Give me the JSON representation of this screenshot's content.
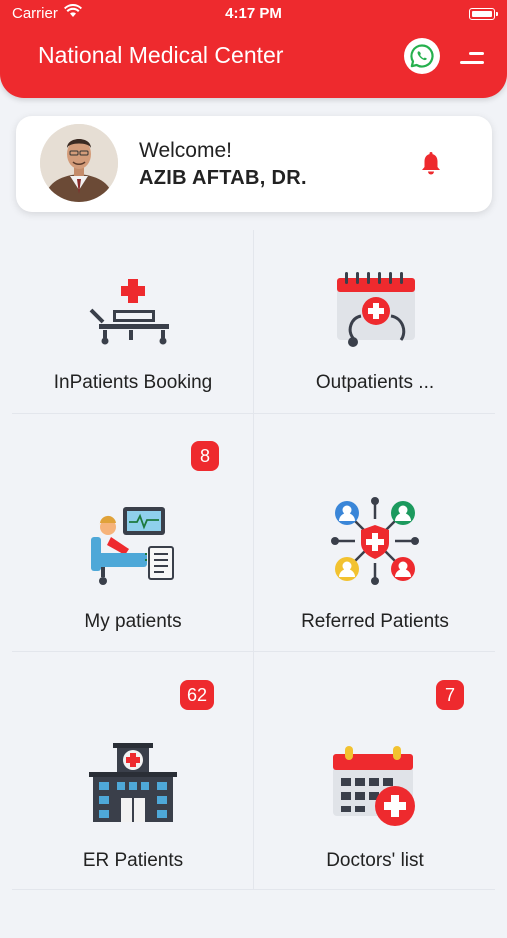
{
  "status_bar": {
    "carrier": "Carrier",
    "time": "4:17 PM"
  },
  "header": {
    "title": "National Medical Center"
  },
  "profile": {
    "welcome": "Welcome!",
    "name": "AZIB AFTAB, DR."
  },
  "tiles": [
    {
      "label": "InPatients Booking",
      "badge": ""
    },
    {
      "label": "Outpatients ...",
      "badge": ""
    },
    {
      "label": "My patients",
      "badge": "8"
    },
    {
      "label": "Referred Patients",
      "badge": ""
    },
    {
      "label": "ER Patients",
      "badge": "62"
    },
    {
      "label": "Doctors' list",
      "badge": "7"
    }
  ],
  "colors": {
    "brand": "#ee2a2e",
    "background": "#f1f3f7"
  }
}
